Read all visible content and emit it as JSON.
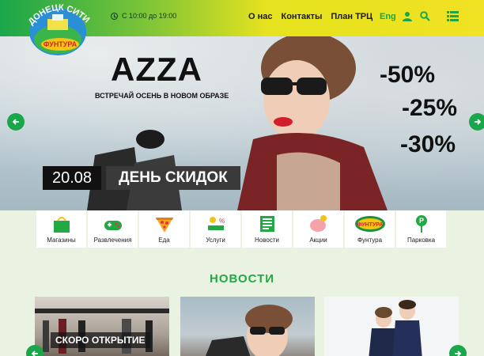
{
  "header": {
    "logo_text": "Донецк Сити Фунтура",
    "hours": "С 10:00 до 19:00",
    "nav": [
      "О нас",
      "Контакты",
      "План ТРЦ"
    ],
    "lang": "Eng"
  },
  "hero": {
    "brand": "AZZA",
    "subtitle": "ВСТРЕЧАЙ ОСЕНЬ В НОВОМ ОБРАЗЕ",
    "discounts": [
      "-50%",
      "-25%",
      "-30%"
    ],
    "date": "20.08",
    "event": "ДЕНЬ СКИДОК"
  },
  "categories": [
    {
      "label": "Магазины",
      "icon": "shopping-bag-icon"
    },
    {
      "label": "Развлечения",
      "icon": "gamepad-icon"
    },
    {
      "label": "Еда",
      "icon": "pizza-icon"
    },
    {
      "label": "Услуги",
      "icon": "services-icon"
    },
    {
      "label": "Новости",
      "icon": "newspaper-icon"
    },
    {
      "label": "Акции",
      "icon": "piggy-bank-icon"
    },
    {
      "label": "Фунтура",
      "icon": "funtura-logo-icon"
    },
    {
      "label": "Парковка",
      "icon": "parking-icon"
    }
  ],
  "news": {
    "title": "НОВОСТИ",
    "cards": [
      {
        "label": "СКОРО ОТКРЫТИЕ"
      }
    ]
  },
  "colors": {
    "brand_green": "#1aa64a",
    "brand_yellow": "#e6e21f",
    "page_bg": "#eaf3e2"
  }
}
